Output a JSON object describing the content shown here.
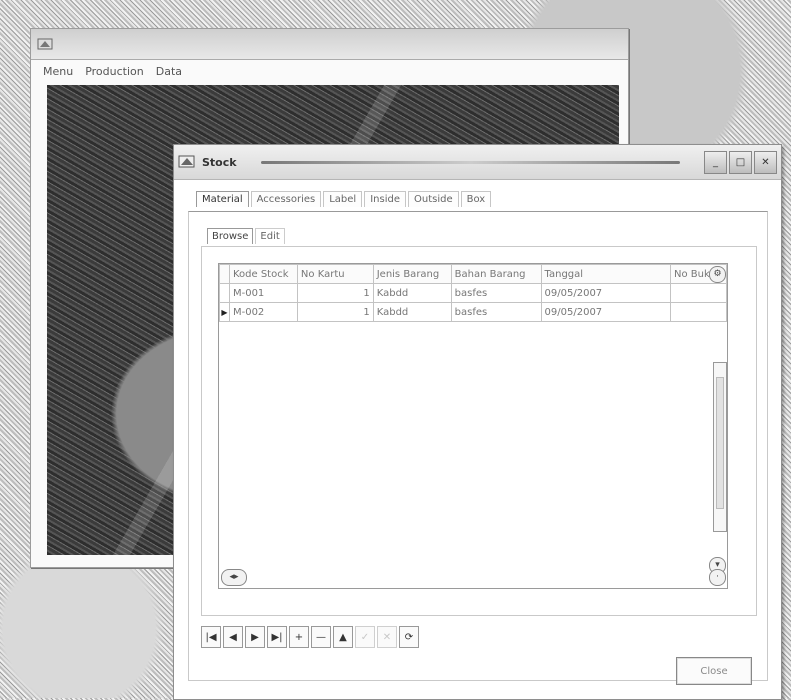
{
  "bg_window": {
    "title": "",
    "menu": [
      "Menu",
      "Production",
      "Data"
    ]
  },
  "dialog": {
    "title": "Stock",
    "tabs": [
      "Material",
      "Accessories",
      "Label",
      "Inside",
      "Outside",
      "Box"
    ],
    "subtabs": [
      "Browse",
      "Edit"
    ],
    "grid": {
      "columns": [
        "Kode Stock",
        "No Kartu",
        "Jenis Barang",
        "Bahan Barang",
        "Tanggal",
        "No Bukti"
      ],
      "rows": [
        {
          "indicator": "",
          "cells": [
            "M-001",
            "1",
            "Kabdd",
            "basfes",
            "09/05/2007",
            ""
          ]
        },
        {
          "indicator": "▶",
          "cells": [
            "M-002",
            "1",
            "Kabdd",
            "basfes",
            "09/05/2007",
            ""
          ]
        }
      ]
    },
    "nav_buttons": [
      "|◀",
      "◀",
      "▶",
      "▶|",
      "+",
      "—",
      "▲",
      "✓",
      "✕",
      "⟳"
    ],
    "close_label": "Close"
  },
  "colors": {
    "title_bar": "#d8d8d8",
    "grid_border": "#c3c3c3"
  }
}
